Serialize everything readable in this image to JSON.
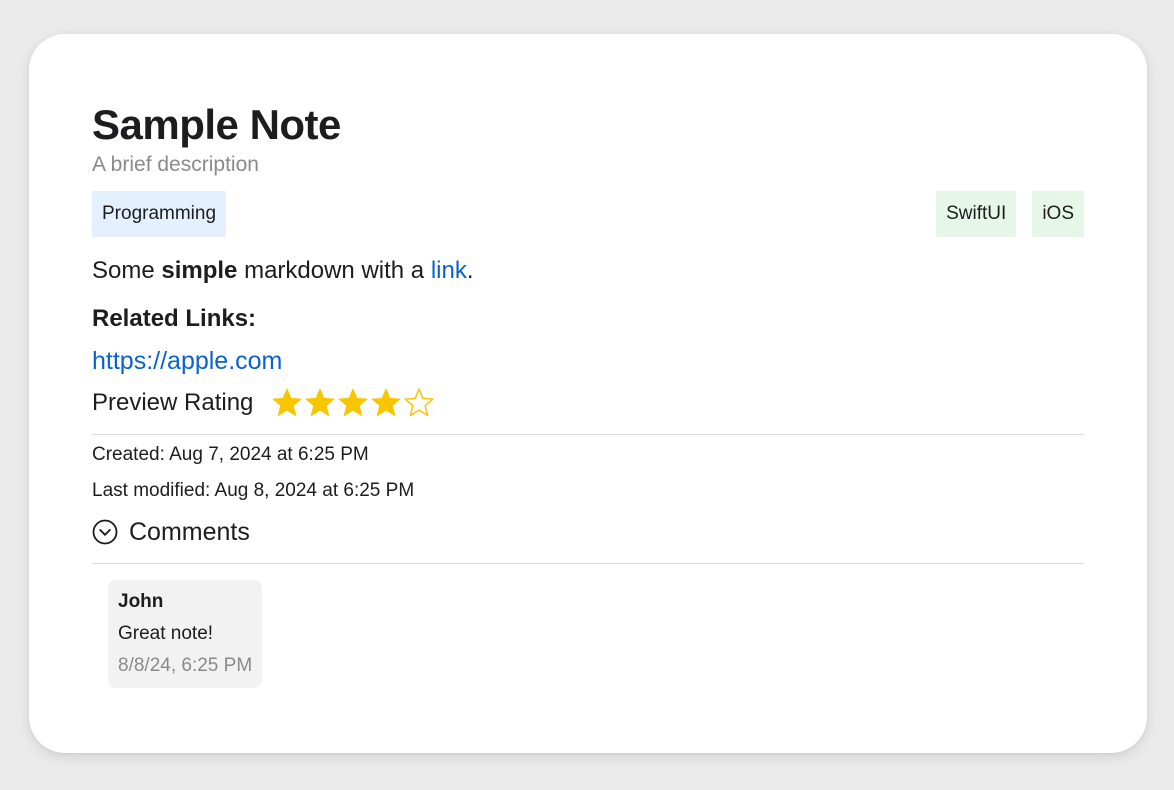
{
  "note": {
    "title": "Sample Note",
    "description": "A brief description",
    "category": "Programming",
    "tags": [
      "SwiftUI",
      "iOS"
    ],
    "body": {
      "prefix": "Some ",
      "bold": "simple",
      "middle": " markdown with a ",
      "link_text": "link",
      "suffix": "."
    },
    "related_links_heading": "Related Links:",
    "related_links": [
      "https://apple.com"
    ],
    "rating_label": "Preview Rating",
    "rating": {
      "value": 4,
      "max": 5
    },
    "created": "Created: Aug 7, 2024 at 6:25 PM",
    "modified": "Last modified: Aug 8, 2024 at 6:25 PM",
    "comments_label": "Comments",
    "comments": [
      {
        "author": "John",
        "text": "Great note!",
        "date": "8/8/24, 6:25 PM"
      }
    ]
  },
  "colors": {
    "link": "#0a62d0",
    "star": "#f7c600",
    "category_bg": "#e4f0fd",
    "tag_bg": "#e6f7e9"
  },
  "icons": {
    "star_filled": "star-filled-icon",
    "star_empty": "star-outline-icon",
    "comments_toggle": "chevron-down-circle-icon"
  }
}
